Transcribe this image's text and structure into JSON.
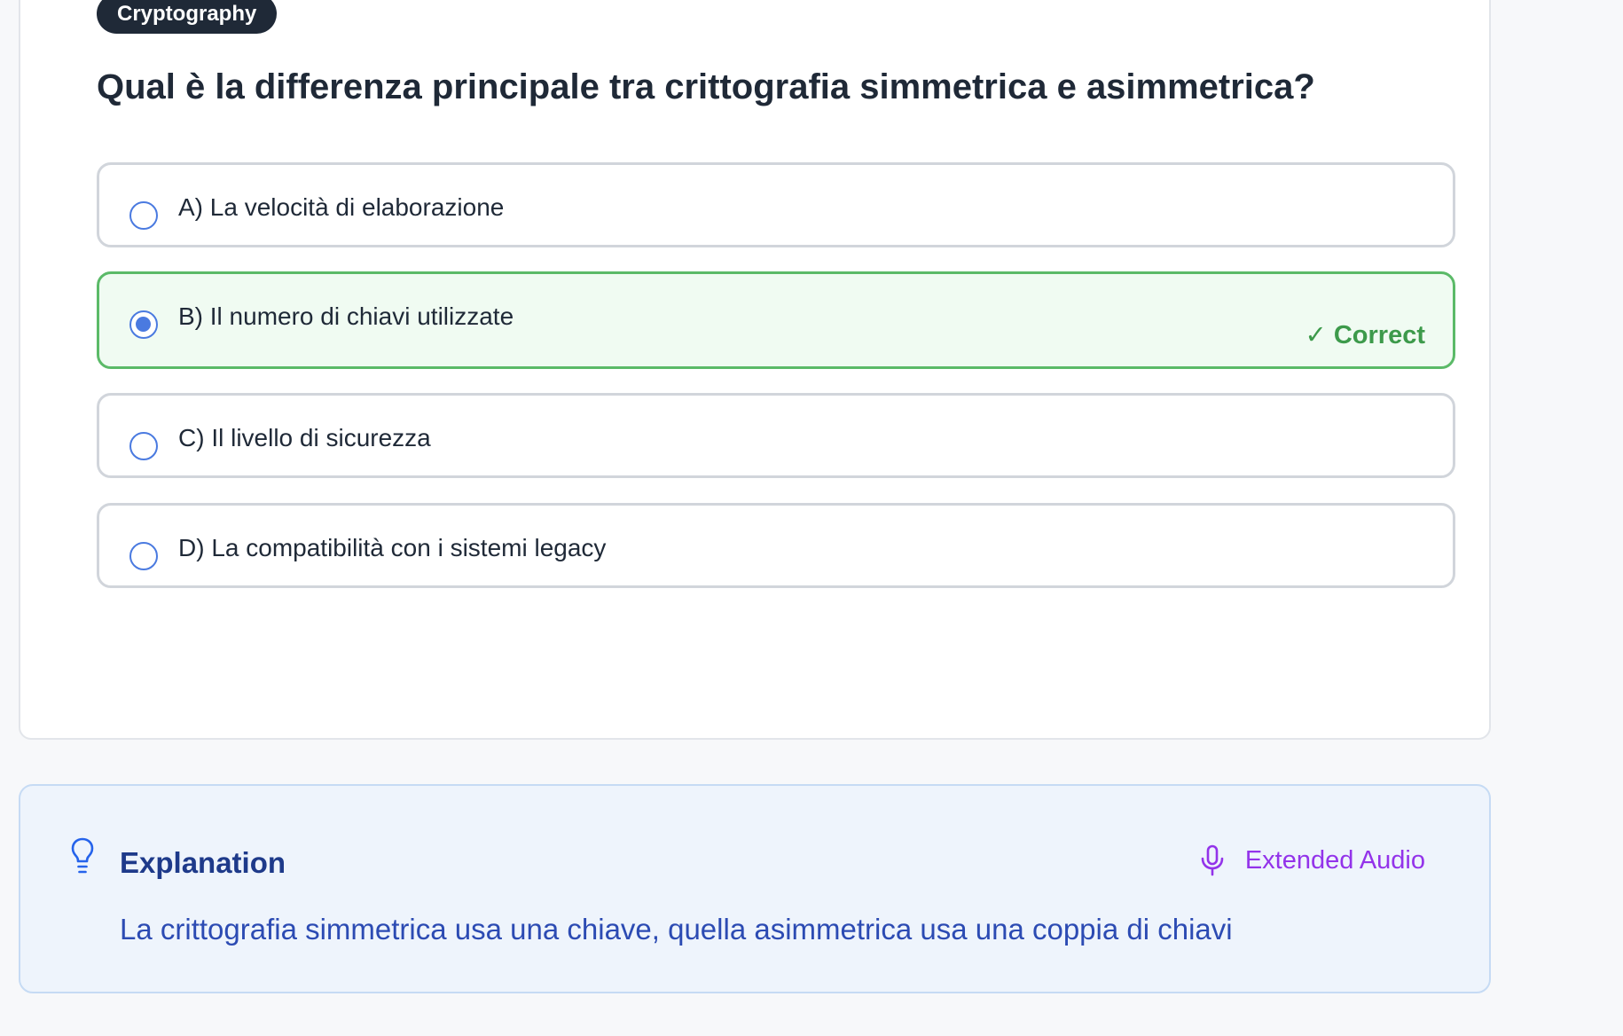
{
  "question": {
    "category": "Cryptography",
    "title": "Qual è la differenza principale tra crittografia simmetrica e asimmetrica?",
    "options": [
      {
        "label": "A) La velocità di elaborazione",
        "selected": false
      },
      {
        "label": "B) Il numero di chiavi utilizzate",
        "selected": true,
        "status": "✓ Correct"
      },
      {
        "label": "C) Il livello di sicurezza",
        "selected": false
      },
      {
        "label": "D) La compatibilità con i sistemi legacy",
        "selected": false
      }
    ]
  },
  "explanation": {
    "icon": "lightbulb-icon",
    "title": "Explanation",
    "audio_icon": "microphone-icon",
    "audio_label": "Extended Audio",
    "text": "La crittografia simmetrica usa una chiave, quella asimmetrica usa una coppia di chiavi"
  },
  "colors": {
    "accent_blue": "#4a7ae0",
    "correct_green": "#3d9a4b",
    "audio_purple": "#9333ea",
    "explanation_text": "#2c4bb3"
  }
}
